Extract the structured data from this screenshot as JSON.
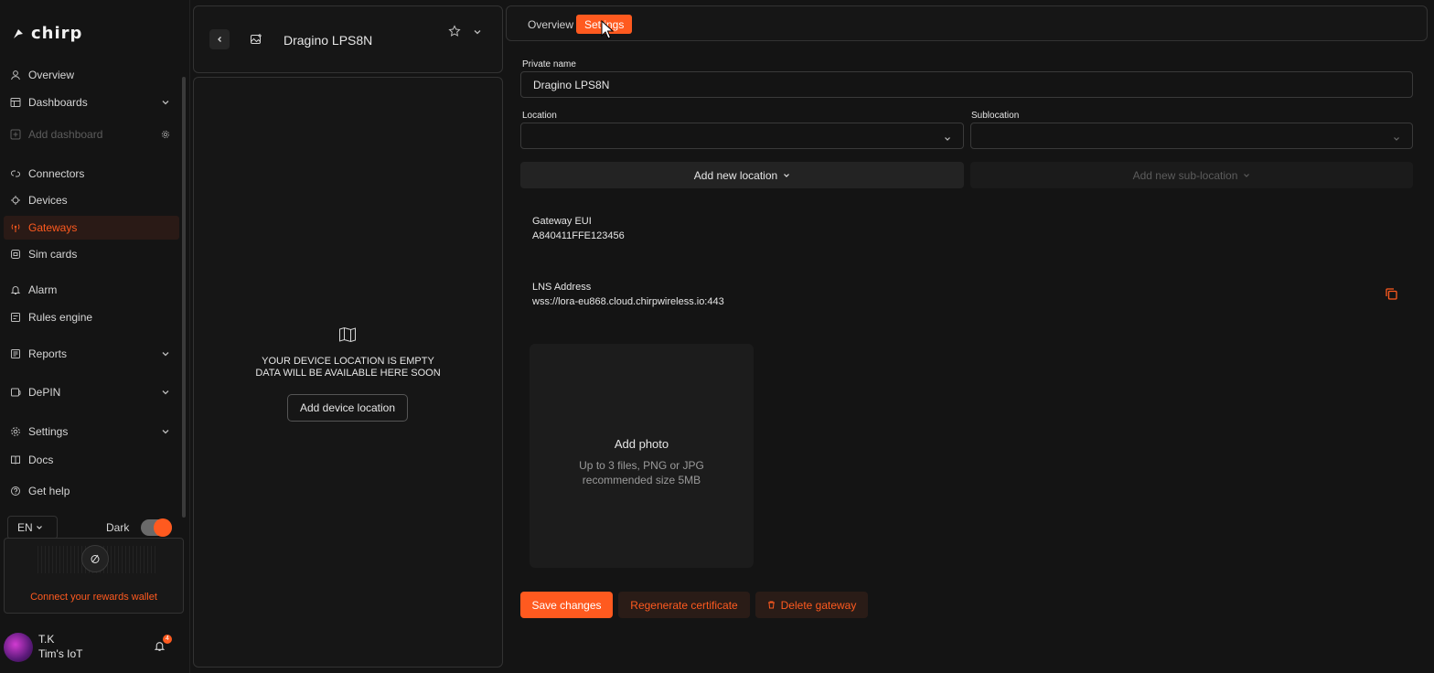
{
  "brand": {
    "name": "chirp",
    "accent": "#ff5a1f"
  },
  "sidebar": {
    "items": [
      {
        "label": "Overview",
        "icon": "user-icon"
      },
      {
        "label": "Dashboards",
        "icon": "dashboard-icon",
        "expandable": true
      },
      {
        "label": "Add dashboard",
        "icon": "add-icon",
        "disabled": true
      },
      {
        "label": "Connectors",
        "icon": "connector-icon"
      },
      {
        "label": "Devices",
        "icon": "chip-icon"
      },
      {
        "label": "Gateways",
        "icon": "antenna-icon",
        "active": true
      },
      {
        "label": "Sim cards",
        "icon": "sim-icon"
      },
      {
        "label": "Alarm",
        "icon": "bell-icon"
      },
      {
        "label": "Rules engine",
        "icon": "rules-icon"
      },
      {
        "label": "Reports",
        "icon": "report-icon",
        "expandable": true
      },
      {
        "label": "DePIN",
        "icon": "depin-icon",
        "expandable": true
      },
      {
        "label": "Settings",
        "icon": "gear-icon",
        "expandable": true
      },
      {
        "label": "Docs",
        "icon": "book-icon"
      },
      {
        "label": "Get help",
        "icon": "help-icon"
      }
    ],
    "language": "EN",
    "theme_label": "Dark",
    "theme_dark": true,
    "rewards_link": "Connect your rewards wallet",
    "user": {
      "name": "T.K",
      "org": "Tim's IoT",
      "notifications": "4"
    }
  },
  "device": {
    "title": "Dragino LPS8N",
    "empty_line1": "YOUR DEVICE LOCATION IS EMPTY",
    "empty_line2": "DATA WILL BE AVAILABLE HERE SOON",
    "add_location_button": "Add device location"
  },
  "tabs": [
    {
      "label": "Overview",
      "active": false
    },
    {
      "label": "Settings",
      "active": true
    }
  ],
  "form": {
    "private_name_label": "Private name",
    "private_name_value": "Dragino LPS8N",
    "location_label": "Location",
    "location_value": "",
    "sublocation_label": "Sublocation",
    "sublocation_value": "",
    "add_location": "Add new location",
    "add_sublocation": "Add new sub-location",
    "gateway_eui_label": "Gateway EUI",
    "gateway_eui_value": "A840411FFE123456",
    "lns_label": "LNS Address",
    "lns_value": "wss://lora-eu868.cloud.chirpwireless.io:443",
    "photo_title": "Add photo",
    "photo_hint1": "Up to 3 files, PNG or JPG",
    "photo_hint2": "recommended size 5MB"
  },
  "actions": {
    "save": "Save changes",
    "regenerate": "Regenerate certificate",
    "delete": "Delete gateway"
  }
}
